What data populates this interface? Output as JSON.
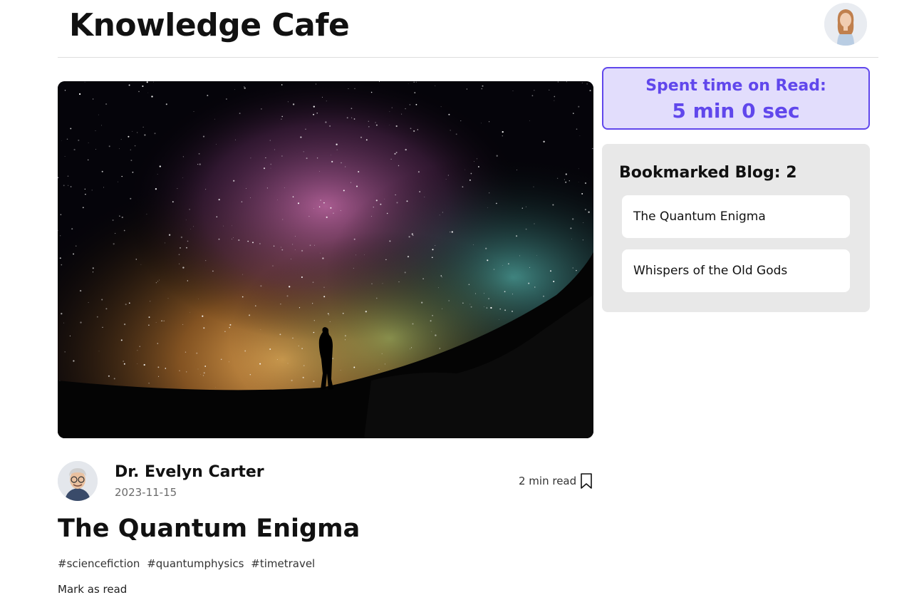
{
  "header": {
    "title": "Knowledge Cafe",
    "avatar_icon": "user-avatar-icon"
  },
  "post": {
    "author": "Dr. Evelyn Carter",
    "date": "2023-11-15",
    "read_time": "2 min read",
    "title": "The Quantum Enigma",
    "hashtags": [
      "#sciencefiction",
      "#quantumphysics",
      "#timetravel"
    ],
    "mark_as_read": "Mark as read",
    "bookmark_icon": "bookmark-icon"
  },
  "sidebar": {
    "timer": {
      "label": "Spent time on Read:",
      "value": "5 min 0 sec"
    },
    "bookmarks": {
      "heading": "Bookmarked Blog: 2",
      "items": [
        "The Quantum Enigma",
        "Whispers of the Old Gods"
      ]
    }
  },
  "colors": {
    "accent": "#6047ec",
    "accent_bg": "#e2ddfc",
    "panel_bg": "#e8e8e8"
  }
}
